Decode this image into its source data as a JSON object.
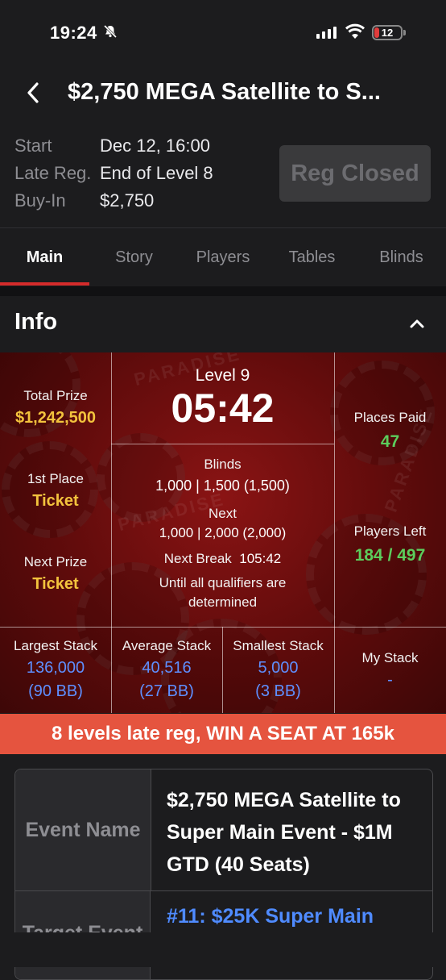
{
  "status": {
    "time": "19:24",
    "battery": "12"
  },
  "header": {
    "title": "$2,750 MEGA Satellite to S..."
  },
  "meta": [
    {
      "label": "Start",
      "value": "Dec 12, 16:00"
    },
    {
      "label": "Late Reg.",
      "value": "End of Level 8"
    },
    {
      "label": "Buy-In",
      "value": "$2,750"
    }
  ],
  "reg_button": "Reg Closed",
  "tabs": [
    "Main",
    "Story",
    "Players",
    "Tables",
    "Blinds"
  ],
  "info": {
    "title": "Info",
    "total_prize_label": "Total Prize",
    "total_prize": "$1,242,500",
    "first_place_label": "1st Place",
    "first_place": "Ticket",
    "next_prize_label": "Next Prize",
    "next_prize": "Ticket",
    "level": "Level 9",
    "clock": "05:42",
    "blinds_label": "Blinds",
    "blinds": "1,000 | 1,500 (1,500)",
    "next_label": "Next",
    "next": "1,000 | 2,000 (2,000)",
    "next_break_label": "Next Break",
    "next_break": "105:42",
    "note": "Until all qualifiers are determined",
    "places_paid_label": "Places Paid",
    "places_paid": "47",
    "players_left_label": "Players Left",
    "players_left": "184 / 497",
    "largest_label": "Largest Stack",
    "largest": "136,000",
    "largest_bb": "(90 BB)",
    "average_label": "Average Stack",
    "average": "40,516",
    "average_bb": "(27 BB)",
    "smallest_label": "Smallest Stack",
    "smallest": "5,000",
    "smallest_bb": "(3 BB)",
    "my_stack_label": "My Stack",
    "my_stack": "-",
    "watermark": "PARADISE"
  },
  "banner": "8 levels late reg, WIN A SEAT AT 165k",
  "event": {
    "name_label": "Event Name",
    "name": "$2,750 MEGA Satellite to Super Main Event - $1M GTD (40 Seats)",
    "target_label": "Target Event",
    "target": "#11: $25K Super Main"
  },
  "colors": {
    "accent": "#d42b2b",
    "banner": "#e5543f",
    "gold": "#f3c33d",
    "green": "#5ccd5c",
    "blue": "#5e8fff"
  }
}
